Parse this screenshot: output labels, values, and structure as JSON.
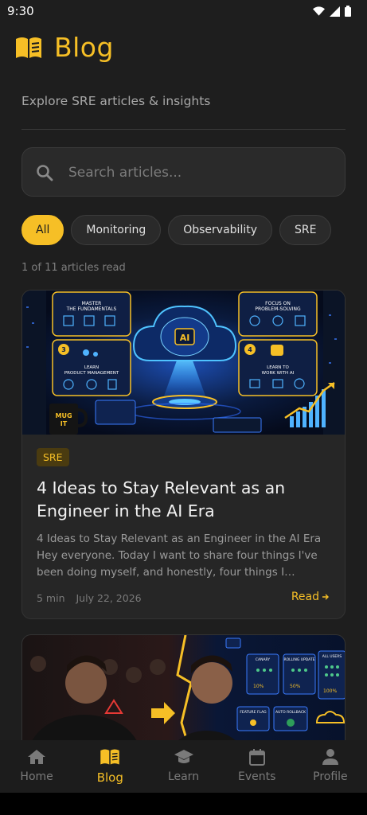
{
  "status_bar": {
    "time": "9:30"
  },
  "header": {
    "title": "Blog",
    "subtitle": "Explore SRE articles & insights"
  },
  "search": {
    "placeholder": "Search articles...",
    "value": ""
  },
  "chips": [
    {
      "label": "All",
      "active": true
    },
    {
      "label": "Monitoring",
      "active": false
    },
    {
      "label": "Observability",
      "active": false
    },
    {
      "label": "SRE",
      "active": false
    }
  ],
  "read_count": "1 of 11 articles read",
  "articles": [
    {
      "tag": "SRE",
      "title": "4 Ideas to Stay Relevant as an Engineer in the AI Era",
      "excerpt": "4 Ideas to Stay Relevant as an Engineer in the AI Era Hey everyone. Today I want to share four things I've been doing myself, and honestly, four things I believe…",
      "read_time": "5 min",
      "date": "July 22, 2026",
      "read_label": "Read",
      "image_labels": {
        "fundamentals": "MASTER THE FUNDAMENTALS",
        "problem": "FOCUS ON PROBLEM-SOLVING",
        "product": "LEARN PRODUCT MANAGEMENT",
        "work": "LEARN TO WORK WITH AI",
        "ai": "AI",
        "mug": "MUG IT",
        "n3": "3",
        "n4": "4"
      }
    },
    {
      "image_labels": {
        "canary": "CANARY",
        "rolling": "ROLLING UPDATE",
        "all": "ALL USERS",
        "p10": "10%",
        "p50": "50%",
        "p100": "100%",
        "flag": "FEATURE FLAG",
        "rollback": "AUTO ROLLBACK"
      }
    }
  ],
  "bottom_nav": [
    {
      "label": "Home",
      "active": false
    },
    {
      "label": "Blog",
      "active": true
    },
    {
      "label": "Learn",
      "active": false
    },
    {
      "label": "Events",
      "active": false
    },
    {
      "label": "Profile",
      "active": false
    }
  ],
  "colors": {
    "accent": "#f6bf26",
    "background": "#1e1e1e",
    "card": "#262626"
  }
}
